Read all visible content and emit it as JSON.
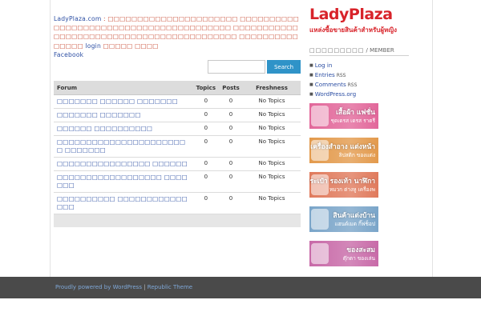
{
  "intro": {
    "site_link": "LadyPlaza.com",
    "separator": " : ",
    "text1": "□□□□□□□□□□□□□□□□□□□□□□ □□□□□□□□□□□□□□□□□□□□□□□□□□□□□□□□□□□□□□□□ □□□□□□□□□□□□□□□□□□□□□□□□□□□□□□□□□□□□□□□□□□ □□□□□□□□□□□□□□□ ",
    "login_link": "login",
    "text2": " □□□□□ □□□□",
    "facebook_link": "Facebook"
  },
  "search": {
    "placeholder": "",
    "button_label": "Search"
  },
  "forum_table": {
    "headers": {
      "forum": "Forum",
      "topics": "Topics",
      "posts": "Posts",
      "freshness": "Freshness"
    },
    "rows": [
      {
        "name": "□□□□□□□ □□□□□□ □□□□□□□",
        "topics": "0",
        "posts": "0",
        "freshness": "No Topics"
      },
      {
        "name": "□□□□□□□ □□□□□□□",
        "topics": "0",
        "posts": "0",
        "freshness": "No Topics"
      },
      {
        "name": "□□□□□□ □□□□□□□□□□",
        "topics": "0",
        "posts": "0",
        "freshness": "No Topics"
      },
      {
        "name": "□□□□□□□□□□□□□□□□□□□□□□□ □□□□□□□",
        "topics": "0",
        "posts": "0",
        "freshness": "No Topics"
      },
      {
        "name": "□□□□□□□□□□□□□□□□ □□□□□□",
        "topics": "0",
        "posts": "0",
        "freshness": "No Topics"
      },
      {
        "name": "□□□□□□□□□□□□□□□□□□ □□□□□□□",
        "topics": "0",
        "posts": "0",
        "freshness": "No Topics"
      },
      {
        "name": "□□□□□□□□□□ □□□□□□□□□□□□□□□",
        "topics": "0",
        "posts": "0",
        "freshness": "No Topics"
      }
    ]
  },
  "logo": {
    "title": "LadyPlaza",
    "tagline": "แหล่งซื้อขายสินค้าสำหรับผู้หญิง"
  },
  "sidebar": {
    "heading": "□□□□□□□□□",
    "heading_sub": " / MEMBER",
    "links": [
      {
        "label": "Log in",
        "suffix": ""
      },
      {
        "label": "Entries",
        "suffix": " RSS"
      },
      {
        "label": "Comments",
        "suffix": " RSS"
      },
      {
        "label": "WordPress.org",
        "suffix": ""
      }
    ]
  },
  "banners": [
    {
      "title": "เสื้อผ้า แฟชั่น",
      "subtitle": "ชุดเดรส เดรส ราตรี",
      "color": "#e2679a"
    },
    {
      "title": "เครื่องสำอาง แต่งหน้า",
      "subtitle": "ลิปสติก ของแต่ง",
      "color": "#e39a4c"
    },
    {
      "title": "กระเป๋า รองเท้า นาฬิกา",
      "subtitle": "หมวก ต่างหู เครื่องพ",
      "color": "#e07a5c"
    },
    {
      "title": "สินค้าแต่งบ้าน",
      "subtitle": "แฮนด์เมด กิ๊ฟช็อป",
      "color": "#7aa5c9"
    },
    {
      "title": "ของสะสม",
      "subtitle": "ตุ๊กตา ของเล่น",
      "color": "#c86aa8"
    }
  ],
  "footer": {
    "powered": "Proudly powered by WordPress",
    "sep": " | ",
    "theme": "Republic Theme"
  },
  "colors": {
    "accent_blue": "#2f93c8",
    "brand_red": "#d8232a",
    "link": "#2c4ea3",
    "intro_text": "#c8482f",
    "footer_bg": "#4a4a4a"
  }
}
